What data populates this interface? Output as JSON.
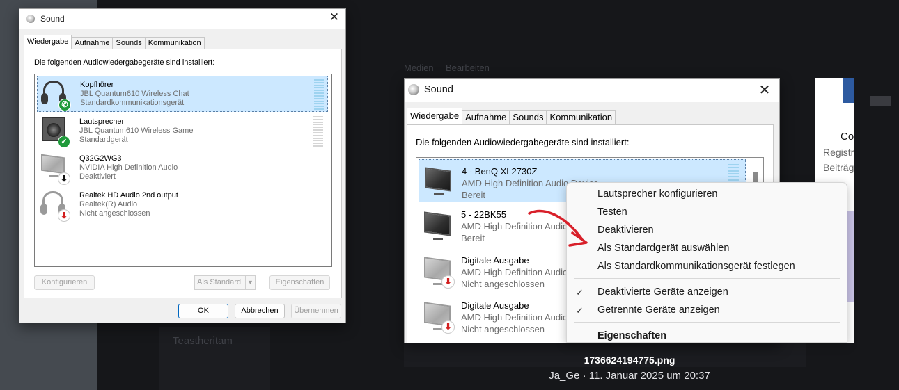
{
  "background": {
    "ghost_texts": [
      "Medien",
      "Bearbeiten",
      "Co",
      "Registr",
      "Beiträg",
      "Teastheritam"
    ],
    "right_panel": {
      "line1": "Co",
      "line2": "Registr",
      "line3": "Beiträg"
    }
  },
  "caption": {
    "filename": "1736624194775.png",
    "meta": "Ja_Ge · 11. Januar 2025 um 20:37"
  },
  "dialog_left": {
    "title": "Sound",
    "tabs": [
      "Wiedergabe",
      "Aufnahme",
      "Sounds",
      "Kommunikation"
    ],
    "intro": "Die folgenden Audiowiedergabegeräte sind installiert:",
    "devices": [
      {
        "name": "Kopfhörer",
        "line1": "JBL Quantum610 Wireless Chat",
        "line2": "Standardkommunikationsgerät",
        "icon": "headset-icon",
        "badge": "phone-check"
      },
      {
        "name": "Lautsprecher",
        "line1": "JBL Quantum610 Wireless Game",
        "line2": "Standardgerät",
        "icon": "speaker-icon",
        "badge": "check"
      },
      {
        "name": "Q32G2WG3",
        "line1": "NVIDIA High Definition Audio",
        "line2": "Deaktiviert",
        "icon": "monitor-icon",
        "badge": "down-arrow"
      },
      {
        "name": "Realtek HD Audio 2nd output",
        "line1": "Realtek(R) Audio",
        "line2": "Nicht angeschlossen",
        "icon": "headset-icon",
        "badge": "down-arrow-red"
      }
    ],
    "buttons": {
      "configure": "Konfigurieren",
      "default": "Als Standard",
      "properties": "Eigenschaften",
      "ok": "OK",
      "cancel": "Abbrechen",
      "apply": "Übernehmen"
    }
  },
  "dialog_right": {
    "title": "Sound",
    "tabs": [
      "Wiedergabe",
      "Aufnahme",
      "Sounds",
      "Kommunikation"
    ],
    "intro": "Die folgenden Audiowiedergabegeräte sind installiert:",
    "devices": [
      {
        "name": "4 - BenQ XL2730Z",
        "line1": "AMD High Definition Audio Device",
        "line2": "Bereit",
        "icon": "monitor-icon"
      },
      {
        "name": "5 - 22BK55",
        "line1": "AMD High Definition Audio",
        "line2": "Bereit",
        "icon": "monitor-icon"
      },
      {
        "name": "Digitale Ausgabe",
        "line1": "AMD High Definition Audio",
        "line2": "Nicht angeschlossen",
        "icon": "monitor-icon"
      },
      {
        "name": "Digitale Ausgabe",
        "line1": "AMD High Definition Audio",
        "line2": "Nicht angeschlossen",
        "icon": "monitor-icon"
      }
    ]
  },
  "context_menu": {
    "items": [
      "Lautsprecher konfigurieren",
      "Testen",
      "Deaktivieren",
      "Als Standardgerät auswählen",
      "Als Standardkommunikationsgerät festlegen"
    ],
    "checked_items": [
      "Deaktivierte Geräte anzeigen",
      "Getrennte Geräte anzeigen"
    ],
    "properties": "Eigenschaften"
  },
  "colors": {
    "selection": "#cce8ff",
    "annotation_arrow": "#d8202a",
    "accent": "#0067c0"
  }
}
